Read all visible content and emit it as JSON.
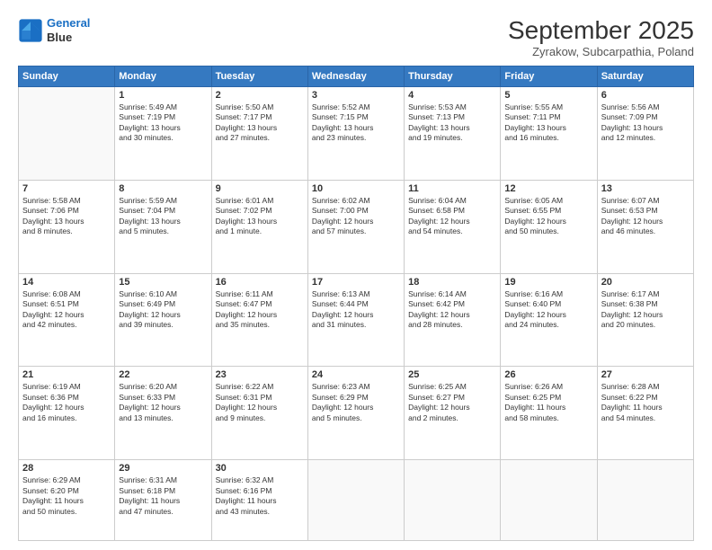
{
  "header": {
    "logo_line1": "General",
    "logo_line2": "Blue",
    "month": "September 2025",
    "location": "Zyrakow, Subcarpathia, Poland"
  },
  "days_of_week": [
    "Sunday",
    "Monday",
    "Tuesday",
    "Wednesday",
    "Thursday",
    "Friday",
    "Saturday"
  ],
  "weeks": [
    [
      {
        "day": "",
        "info": ""
      },
      {
        "day": "1",
        "info": "Sunrise: 5:49 AM\nSunset: 7:19 PM\nDaylight: 13 hours\nand 30 minutes."
      },
      {
        "day": "2",
        "info": "Sunrise: 5:50 AM\nSunset: 7:17 PM\nDaylight: 13 hours\nand 27 minutes."
      },
      {
        "day": "3",
        "info": "Sunrise: 5:52 AM\nSunset: 7:15 PM\nDaylight: 13 hours\nand 23 minutes."
      },
      {
        "day": "4",
        "info": "Sunrise: 5:53 AM\nSunset: 7:13 PM\nDaylight: 13 hours\nand 19 minutes."
      },
      {
        "day": "5",
        "info": "Sunrise: 5:55 AM\nSunset: 7:11 PM\nDaylight: 13 hours\nand 16 minutes."
      },
      {
        "day": "6",
        "info": "Sunrise: 5:56 AM\nSunset: 7:09 PM\nDaylight: 13 hours\nand 12 minutes."
      }
    ],
    [
      {
        "day": "7",
        "info": "Sunrise: 5:58 AM\nSunset: 7:06 PM\nDaylight: 13 hours\nand 8 minutes."
      },
      {
        "day": "8",
        "info": "Sunrise: 5:59 AM\nSunset: 7:04 PM\nDaylight: 13 hours\nand 5 minutes."
      },
      {
        "day": "9",
        "info": "Sunrise: 6:01 AM\nSunset: 7:02 PM\nDaylight: 13 hours\nand 1 minute."
      },
      {
        "day": "10",
        "info": "Sunrise: 6:02 AM\nSunset: 7:00 PM\nDaylight: 12 hours\nand 57 minutes."
      },
      {
        "day": "11",
        "info": "Sunrise: 6:04 AM\nSunset: 6:58 PM\nDaylight: 12 hours\nand 54 minutes."
      },
      {
        "day": "12",
        "info": "Sunrise: 6:05 AM\nSunset: 6:55 PM\nDaylight: 12 hours\nand 50 minutes."
      },
      {
        "day": "13",
        "info": "Sunrise: 6:07 AM\nSunset: 6:53 PM\nDaylight: 12 hours\nand 46 minutes."
      }
    ],
    [
      {
        "day": "14",
        "info": "Sunrise: 6:08 AM\nSunset: 6:51 PM\nDaylight: 12 hours\nand 42 minutes."
      },
      {
        "day": "15",
        "info": "Sunrise: 6:10 AM\nSunset: 6:49 PM\nDaylight: 12 hours\nand 39 minutes."
      },
      {
        "day": "16",
        "info": "Sunrise: 6:11 AM\nSunset: 6:47 PM\nDaylight: 12 hours\nand 35 minutes."
      },
      {
        "day": "17",
        "info": "Sunrise: 6:13 AM\nSunset: 6:44 PM\nDaylight: 12 hours\nand 31 minutes."
      },
      {
        "day": "18",
        "info": "Sunrise: 6:14 AM\nSunset: 6:42 PM\nDaylight: 12 hours\nand 28 minutes."
      },
      {
        "day": "19",
        "info": "Sunrise: 6:16 AM\nSunset: 6:40 PM\nDaylight: 12 hours\nand 24 minutes."
      },
      {
        "day": "20",
        "info": "Sunrise: 6:17 AM\nSunset: 6:38 PM\nDaylight: 12 hours\nand 20 minutes."
      }
    ],
    [
      {
        "day": "21",
        "info": "Sunrise: 6:19 AM\nSunset: 6:36 PM\nDaylight: 12 hours\nand 16 minutes."
      },
      {
        "day": "22",
        "info": "Sunrise: 6:20 AM\nSunset: 6:33 PM\nDaylight: 12 hours\nand 13 minutes."
      },
      {
        "day": "23",
        "info": "Sunrise: 6:22 AM\nSunset: 6:31 PM\nDaylight: 12 hours\nand 9 minutes."
      },
      {
        "day": "24",
        "info": "Sunrise: 6:23 AM\nSunset: 6:29 PM\nDaylight: 12 hours\nand 5 minutes."
      },
      {
        "day": "25",
        "info": "Sunrise: 6:25 AM\nSunset: 6:27 PM\nDaylight: 12 hours\nand 2 minutes."
      },
      {
        "day": "26",
        "info": "Sunrise: 6:26 AM\nSunset: 6:25 PM\nDaylight: 11 hours\nand 58 minutes."
      },
      {
        "day": "27",
        "info": "Sunrise: 6:28 AM\nSunset: 6:22 PM\nDaylight: 11 hours\nand 54 minutes."
      }
    ],
    [
      {
        "day": "28",
        "info": "Sunrise: 6:29 AM\nSunset: 6:20 PM\nDaylight: 11 hours\nand 50 minutes."
      },
      {
        "day": "29",
        "info": "Sunrise: 6:31 AM\nSunset: 6:18 PM\nDaylight: 11 hours\nand 47 minutes."
      },
      {
        "day": "30",
        "info": "Sunrise: 6:32 AM\nSunset: 6:16 PM\nDaylight: 11 hours\nand 43 minutes."
      },
      {
        "day": "",
        "info": ""
      },
      {
        "day": "",
        "info": ""
      },
      {
        "day": "",
        "info": ""
      },
      {
        "day": "",
        "info": ""
      }
    ]
  ]
}
